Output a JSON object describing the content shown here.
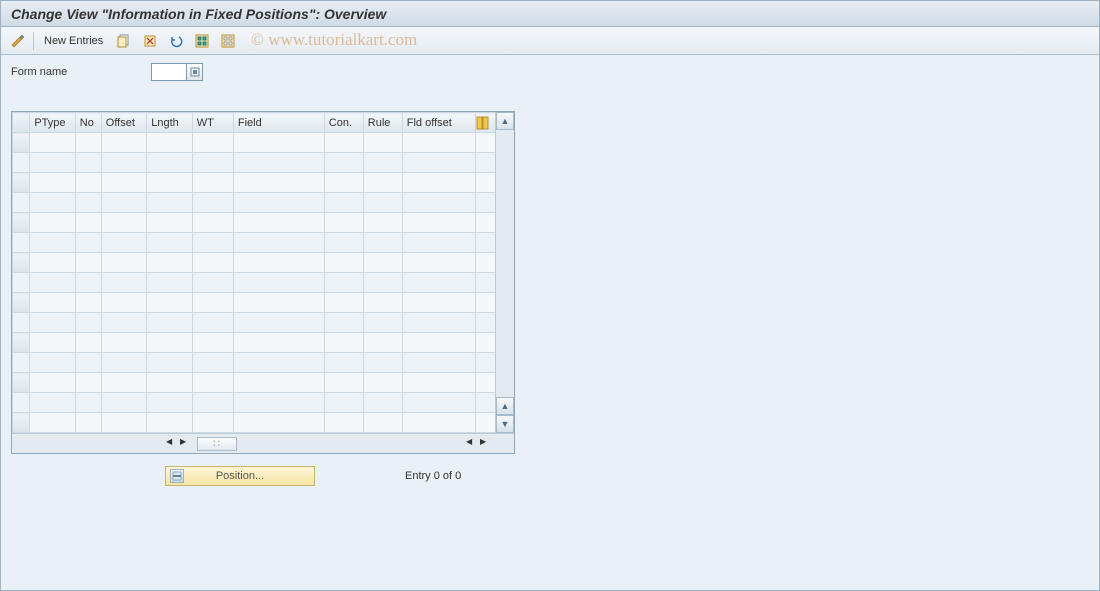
{
  "title": "Change View \"Information in Fixed Positions\": Overview",
  "toolbar": {
    "new_entries": "New Entries"
  },
  "watermark": "© www.tutorialkart.com",
  "form": {
    "label": "Form name",
    "value": ""
  },
  "table": {
    "columns": [
      "PType",
      "No",
      "Offset",
      "Lngth",
      "WT",
      "Field",
      "Con.",
      "Rule",
      "Fld offset"
    ],
    "row_count": 15
  },
  "position_button": "Position...",
  "entry_status": "Entry 0 of 0"
}
